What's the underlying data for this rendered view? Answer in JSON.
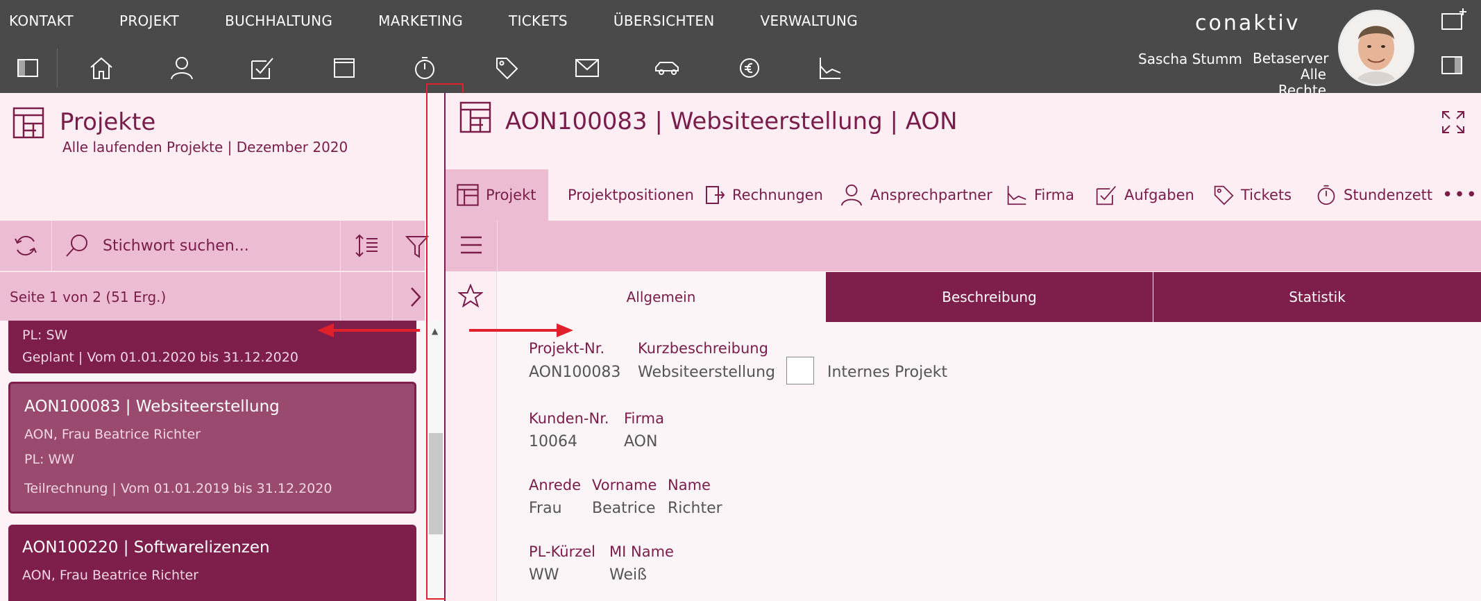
{
  "menu": [
    "KONTAKT",
    "PROJEKT",
    "BUCHHALTUNG",
    "MARKETING",
    "TICKETS",
    "ÜBERSICHTEN",
    "VERWALTUNG"
  ],
  "toolbar_icons": [
    "sidebar-toggle-icon",
    "home-icon",
    "contact-icon",
    "task-icon",
    "project-icon",
    "timer-icon",
    "ticket-icon",
    "mail-icon",
    "car-icon",
    "euro-settings-icon",
    "chart-icon"
  ],
  "brand": {
    "logo": "conaktiv"
  },
  "user": {
    "name": "Sascha Stumm",
    "server": "Betaserver",
    "rights": "Alle Rechte"
  },
  "left": {
    "title": "Projekte",
    "subtitle": "Alle laufenden Projekte | Dezember 2020",
    "search_placeholder": "Stichwort suchen...",
    "pager": "Seite 1 von 2 (51 Erg.)",
    "cards": [
      {
        "line_pl": "PL: SW",
        "status": "Geplant | Vom 01.01.2020 bis 31.12.2020"
      },
      {
        "title": "AON100083 | Websiteerstellung",
        "customer": "AON,  Frau Beatrice Richter",
        "pl": "PL: WW",
        "status": "Teilrechnung | Vom 01.01.2019 bis 31.12.2020"
      },
      {
        "title": "AON100220 | Softwarelizenzen",
        "customer": "AON,  Frau Beatrice Richter"
      }
    ]
  },
  "right": {
    "title": "AON100083 | Websiteerstellung | AON",
    "tabs": [
      "Projekt",
      "Projektpositionen",
      "Rechnungen",
      "Ansprechpartner",
      "Firma",
      "Aufgaben",
      "Tickets",
      "Stundenzett"
    ],
    "subtabs": [
      "Allgemein",
      "Beschreibung",
      "Statistik"
    ],
    "form": {
      "projekt_nr_label": "Projekt-Nr.",
      "projekt_nr": "AON100083",
      "kurz_label": "Kurzbeschreibung",
      "kurz": "Websiteerstellung",
      "internes_label": "Internes Projekt",
      "kunden_nr_label": "Kunden-Nr.",
      "kunden_nr": "10064",
      "firma_label": "Firma",
      "firma": "AON",
      "anrede_label": "Anrede",
      "anrede": "Frau",
      "vorname_label": "Vorname",
      "vorname": "Beatrice",
      "name_label": "Name",
      "name": "Richter",
      "pl_label": "PL-Kürzel",
      "pl": "WW",
      "mi_label": "MI Name",
      "mi": "Weiß"
    }
  },
  "colors": {
    "brand": "#7a1c4a",
    "card": "#7d1e4b",
    "toolbar": "#ecbcd2",
    "topbar": "#4a4a4a",
    "annotation": "#e0202a"
  }
}
